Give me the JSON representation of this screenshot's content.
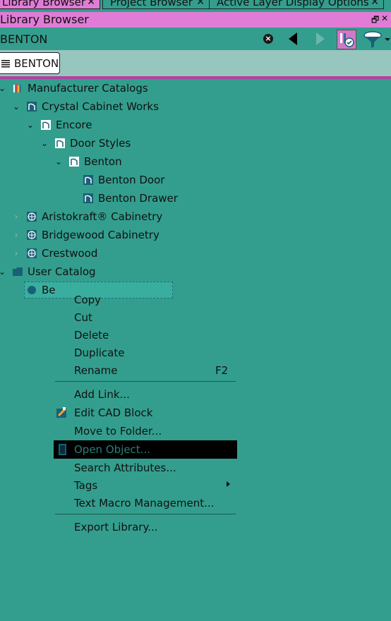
{
  "tabs": [
    {
      "label": "Library Browser",
      "active": true
    },
    {
      "label": "Project Browser",
      "active": false
    },
    {
      "label": "Active Layer Display Options",
      "active": false
    }
  ],
  "tab_close_glyph": "✕",
  "panel": {
    "title": "Library Browser",
    "float_glyph": "🗗",
    "close_glyph": "✕"
  },
  "search": {
    "value": "BENTON",
    "clear_icon": "close-circle-icon"
  },
  "result_chip": {
    "label": "BENTON"
  },
  "tree": [
    {
      "label": "Manufacturer Catalogs",
      "icon": "catalogs-icon",
      "expanded": true
    },
    {
      "label": "Crystal Cabinet Works",
      "icon": "folder-blue-icon",
      "expanded": true
    },
    {
      "label": "Encore",
      "icon": "folder-blue-icon",
      "expanded": true
    },
    {
      "label": "Door Styles",
      "icon": "folder-blue-icon",
      "expanded": true
    },
    {
      "label": "Benton",
      "icon": "folder-blue-icon",
      "expanded": true
    },
    {
      "label": "Benton Door",
      "icon": "cabinet-door-icon"
    },
    {
      "label": "Benton Drawer",
      "icon": "cabinet-door-icon"
    },
    {
      "label": "Aristokraft® Cabinetry",
      "icon": "globe-icon",
      "expanded": false
    },
    {
      "label": "Bridgewood Cabinetry",
      "icon": "globe-icon",
      "expanded": false
    },
    {
      "label": "Crestwood",
      "icon": "globe-icon",
      "expanded": false
    },
    {
      "label": "User Catalog",
      "icon": "folder-icon",
      "expanded": true
    }
  ],
  "selected_item": {
    "label": "Be"
  },
  "context_menu": {
    "items": [
      {
        "label": "Copy"
      },
      {
        "label": "Cut"
      },
      {
        "label": "Delete"
      },
      {
        "label": "Duplicate"
      },
      {
        "label": "Rename",
        "shortcut": "F2"
      },
      {
        "label": "Add Link..."
      },
      {
        "label": "Edit CAD Block"
      },
      {
        "label": "Move to Folder..."
      },
      {
        "label": "Open Object..."
      },
      {
        "label": "Search Attributes..."
      },
      {
        "label": "Tags"
      },
      {
        "label": "Text Macro Management..."
      },
      {
        "label": "Export Library..."
      }
    ]
  },
  "colors": {
    "background": "#339E8E",
    "accent_pink": "#E07CD6",
    "selection_highlight": "#000000",
    "folder_blue": "#1A5F77"
  }
}
